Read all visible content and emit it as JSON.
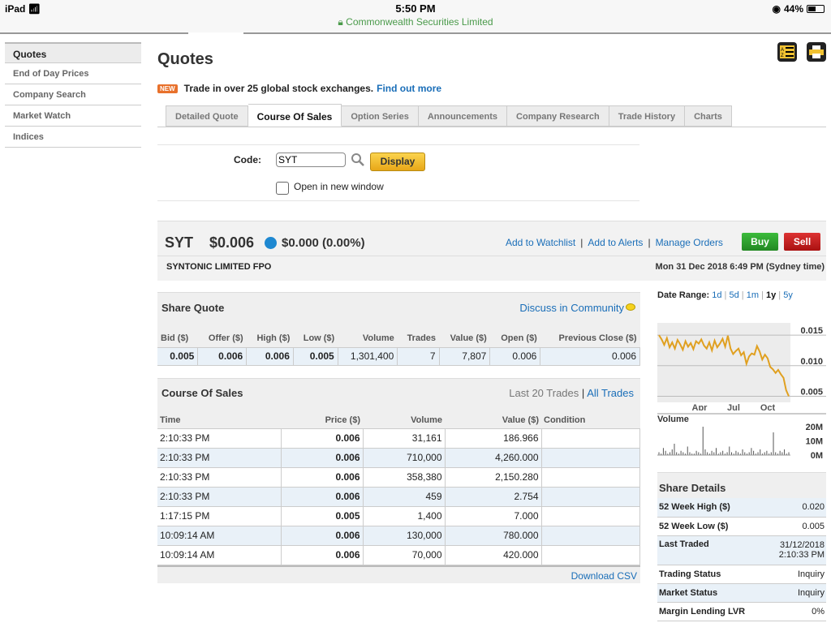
{
  "status": {
    "carrier": "iPad",
    "time": "5:50 PM",
    "site": "Commonwealth Securities Limited",
    "battery": "44%"
  },
  "sidebar": {
    "items": [
      {
        "label": "Quotes"
      },
      {
        "label": "End of Day Prices"
      },
      {
        "label": "Company Search"
      },
      {
        "label": "Market Watch"
      },
      {
        "label": "Indices"
      }
    ]
  },
  "page": {
    "title": "Quotes",
    "promo_badge": "NEW",
    "promo_text": "Trade in over 25 global stock exchanges.",
    "promo_link": "Find out more"
  },
  "tabs": [
    {
      "label": "Detailed Quote"
    },
    {
      "label": "Course Of Sales"
    },
    {
      "label": "Option Series"
    },
    {
      "label": "Announcements"
    },
    {
      "label": "Company Research"
    },
    {
      "label": "Trade History"
    },
    {
      "label": "Charts"
    }
  ],
  "form": {
    "code_label": "Code:",
    "code_value": "SYT",
    "display_label": "Display",
    "new_window_label": "Open in new window"
  },
  "summary": {
    "symbol": "SYT",
    "price": "$0.006",
    "change": "$0.000 (0.00%)",
    "watchlist": "Add to Watchlist",
    "alerts": "Add to Alerts",
    "orders": "Manage Orders",
    "buy": "Buy",
    "sell": "Sell",
    "company": "SYNTONIC LIMITED FPO",
    "date": "Mon 31 Dec 2018 6:49 PM (Sydney time)"
  },
  "share_quote": {
    "title": "Share Quote",
    "discuss": "Discuss in Community",
    "headers": [
      "Bid ($)",
      "Offer ($)",
      "High ($)",
      "Low ($)",
      "Volume",
      "Trades",
      "Value ($)",
      "Open ($)",
      "Previous Close ($)"
    ],
    "values": [
      "0.005",
      "0.006",
      "0.006",
      "0.005",
      "1,301,400",
      "7",
      "7,807",
      "0.006",
      "0.006"
    ]
  },
  "course_of_sales": {
    "title": "Course Of Sales",
    "last_trades": "Last 20 Trades",
    "all_trades": "All Trades",
    "headers": [
      "Time",
      "Price ($)",
      "Volume",
      "Value ($)",
      "Condition"
    ],
    "rows": [
      [
        "2:10:33 PM",
        "0.006",
        "31,161",
        "186.966",
        ""
      ],
      [
        "2:10:33 PM",
        "0.006",
        "710,000",
        "4,260.000",
        ""
      ],
      [
        "2:10:33 PM",
        "0.006",
        "358,380",
        "2,150.280",
        ""
      ],
      [
        "2:10:33 PM",
        "0.006",
        "459",
        "2.754",
        ""
      ],
      [
        "1:17:15 PM",
        "0.005",
        "1,400",
        "7.000",
        ""
      ],
      [
        "10:09:14 AM",
        "0.006",
        "130,000",
        "780.000",
        ""
      ],
      [
        "10:09:14 AM",
        "0.006",
        "70,000",
        "420.000",
        ""
      ]
    ],
    "download": "Download CSV"
  },
  "date_range": {
    "label": "Date Range:",
    "options": [
      "1d",
      "5d",
      "1m",
      "1y",
      "5y"
    ],
    "selected": "1y"
  },
  "chart_data": {
    "type": "line",
    "x_tick_labels": [
      "Apr",
      "Jul",
      "Oct"
    ],
    "y_tick_labels": [
      "0.015",
      "0.010",
      "0.005"
    ],
    "ylim": [
      0.004,
      0.017
    ],
    "values": [
      0.015,
      0.0143,
      0.0134,
      0.0145,
      0.013,
      0.0138,
      0.0128,
      0.0142,
      0.0135,
      0.0126,
      0.014,
      0.0131,
      0.0137,
      0.0127,
      0.014,
      0.0136,
      0.0143,
      0.0133,
      0.0128,
      0.0138,
      0.0125,
      0.0141,
      0.013,
      0.0136,
      0.0144,
      0.0131,
      0.0149,
      0.0128,
      0.0119,
      0.0124,
      0.0128,
      0.0117,
      0.0122,
      0.0103,
      0.0115,
      0.012,
      0.0118,
      0.0132,
      0.0123,
      0.011,
      0.0118,
      0.0112,
      0.0098,
      0.0094,
      0.0088,
      0.0093,
      0.0086,
      0.008,
      0.006,
      0.005
    ],
    "volume": {
      "label": "Volume",
      "tick_labels": [
        "20M",
        "10M",
        "0M"
      ],
      "ylim": [
        0,
        24
      ],
      "values": [
        2,
        1,
        5,
        3,
        1,
        2,
        4,
        8,
        2,
        1,
        3,
        2,
        1,
        6,
        2,
        1,
        1,
        3,
        2,
        1,
        20,
        4,
        2,
        1,
        3,
        2,
        5,
        1,
        2,
        3,
        1,
        2,
        6,
        2,
        1,
        3,
        2,
        1,
        4,
        2,
        1,
        2,
        5,
        3,
        1,
        2,
        4,
        1,
        2,
        3,
        1,
        2,
        16,
        2,
        1,
        3,
        2,
        4,
        1,
        2
      ]
    }
  },
  "share_details": {
    "title": "Share Details",
    "rows": [
      {
        "label": "52 Week High ($)",
        "value": "0.020"
      },
      {
        "label": "52 Week Low ($)",
        "value": "0.005"
      },
      {
        "label": "Last Traded",
        "value": "31/12/2018 2:10:33 PM"
      },
      {
        "label": "Trading Status",
        "value": "Inquiry"
      },
      {
        "label": "Market Status",
        "value": "Inquiry"
      },
      {
        "label": "Margin Lending LVR",
        "value": "0%"
      }
    ]
  },
  "colors": {
    "accent": "#1a6eb8",
    "line": "#e0a020",
    "buy": "#2aa02a",
    "sell": "#c21f1f"
  }
}
